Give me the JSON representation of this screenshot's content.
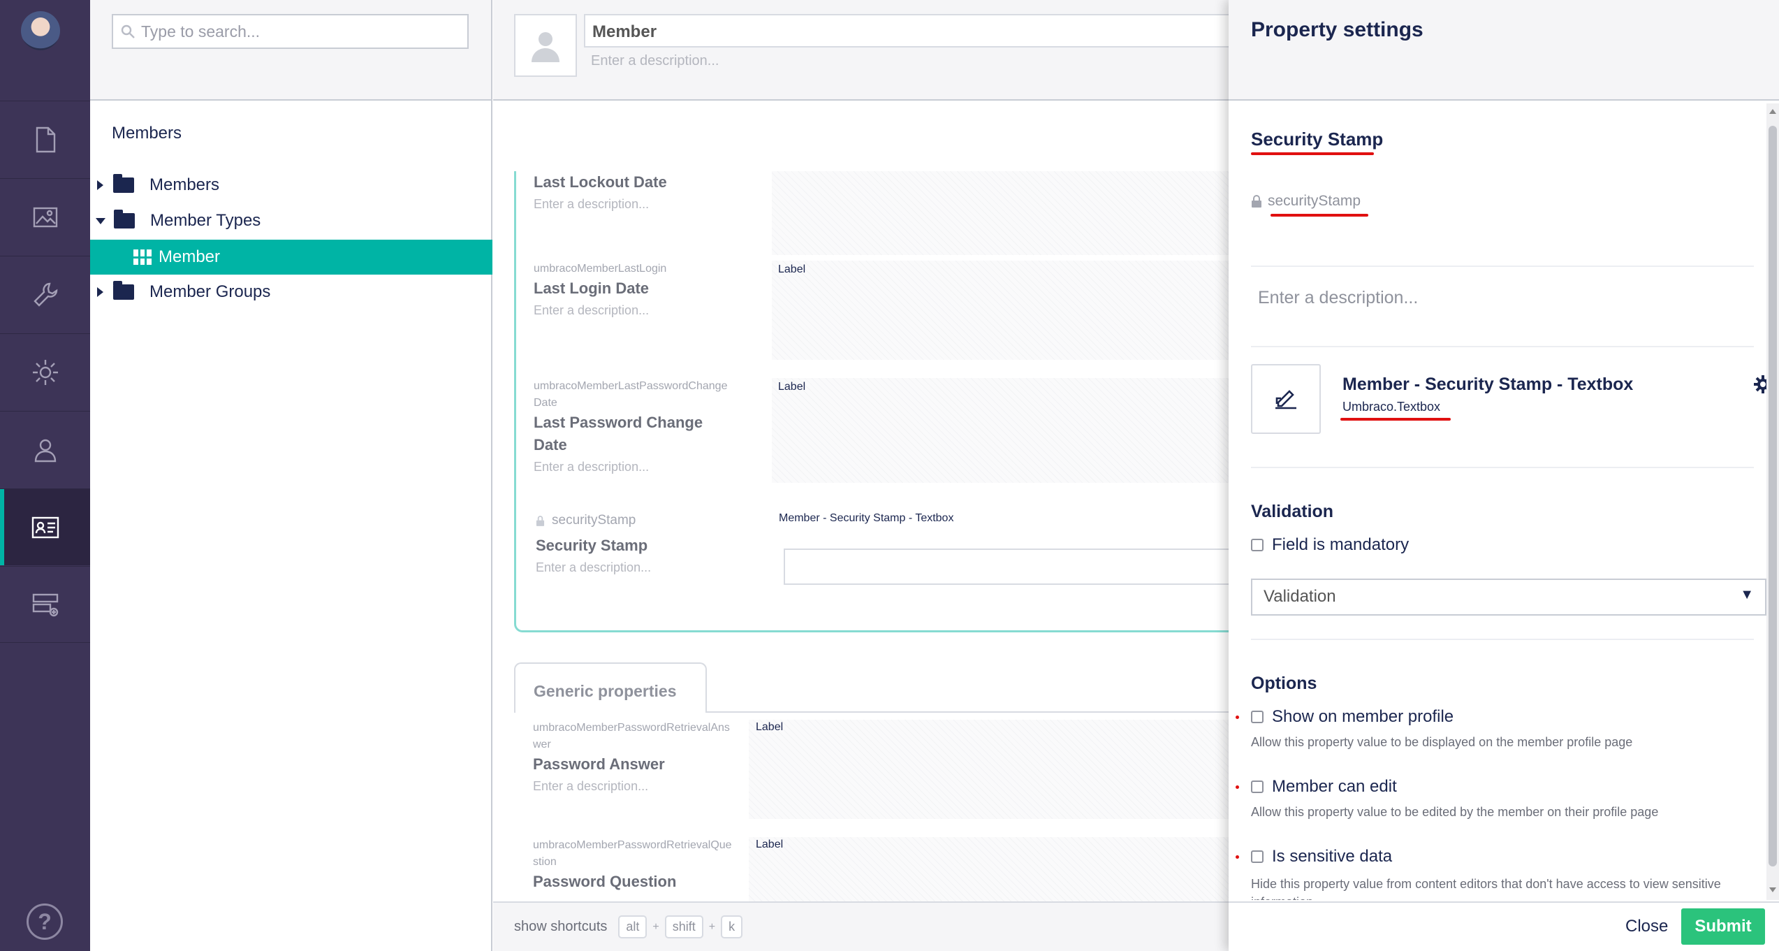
{
  "search": {
    "placeholder": "Type to search..."
  },
  "tree": {
    "root_label": "Members",
    "nodes": [
      {
        "label": "Members"
      },
      {
        "label": "Member Types"
      },
      {
        "label": "Member"
      },
      {
        "label": "Member Groups"
      }
    ]
  },
  "editor": {
    "name_value": "Member",
    "description_placeholder": "Enter a description...",
    "properties": [
      {
        "alias": "",
        "name": "Last Lockout Date",
        "description": "Enter a description...",
        "editor_label": ""
      },
      {
        "alias": "umbracoMemberLastLogin",
        "name": "Last Login Date",
        "description": "Enter a description...",
        "editor_label": "Label"
      },
      {
        "alias": "umbracoMemberLastPasswordChange Date",
        "name": "Last Password Change Date",
        "description": "Enter a description...",
        "editor_label": "Label"
      },
      {
        "alias": "securityStamp",
        "name": "Security Stamp",
        "description": "Enter a description...",
        "editor_label": "Member - Security Stamp - Textbox"
      }
    ],
    "generic_tab": "Generic properties",
    "generic_properties": [
      {
        "alias": "umbracoMemberPasswordRetrievalAns wer",
        "name": "Password Answer",
        "description": "Enter a description...",
        "editor_label": "Label"
      },
      {
        "alias": "umbracoMemberPasswordRetrievalQue stion",
        "name": "Password Question",
        "editor_label": "Label"
      }
    ],
    "shortcuts": {
      "label": "show shortcuts",
      "keys": [
        "alt",
        "shift",
        "k"
      ],
      "plus": "+"
    }
  },
  "panel": {
    "title": "Property settings",
    "property_name": "Security Stamp",
    "alias": "securityStamp",
    "description_placeholder": "Enter a description...",
    "data_type": {
      "name": "Member - Security Stamp - Textbox",
      "alias": "Umbraco.Textbox"
    },
    "validation": {
      "heading": "Validation",
      "mandatory_label": "Field is mandatory",
      "select_value": "Validation"
    },
    "options": {
      "heading": "Options",
      "items": [
        {
          "label": "Show on member profile",
          "help": "Allow this property value to be displayed on the member profile page"
        },
        {
          "label": "Member can edit",
          "help": "Allow this property value to be edited by the member on their profile page"
        },
        {
          "label": "Is sensitive data",
          "help": "Hide this property value from content editors that don't have access to view sensitive information"
        }
      ]
    },
    "close_label": "Close",
    "submit_label": "Submit"
  },
  "colors": {
    "nav_bg": "#3d3457",
    "accent": "#00b4a5",
    "submit": "#2bc37c",
    "annotation": "#e01010"
  },
  "icons": [
    "document-icon",
    "image-icon",
    "wrench-icon",
    "gear-icon",
    "user-icon",
    "member-card-icon",
    "forms-icon",
    "help-icon"
  ]
}
